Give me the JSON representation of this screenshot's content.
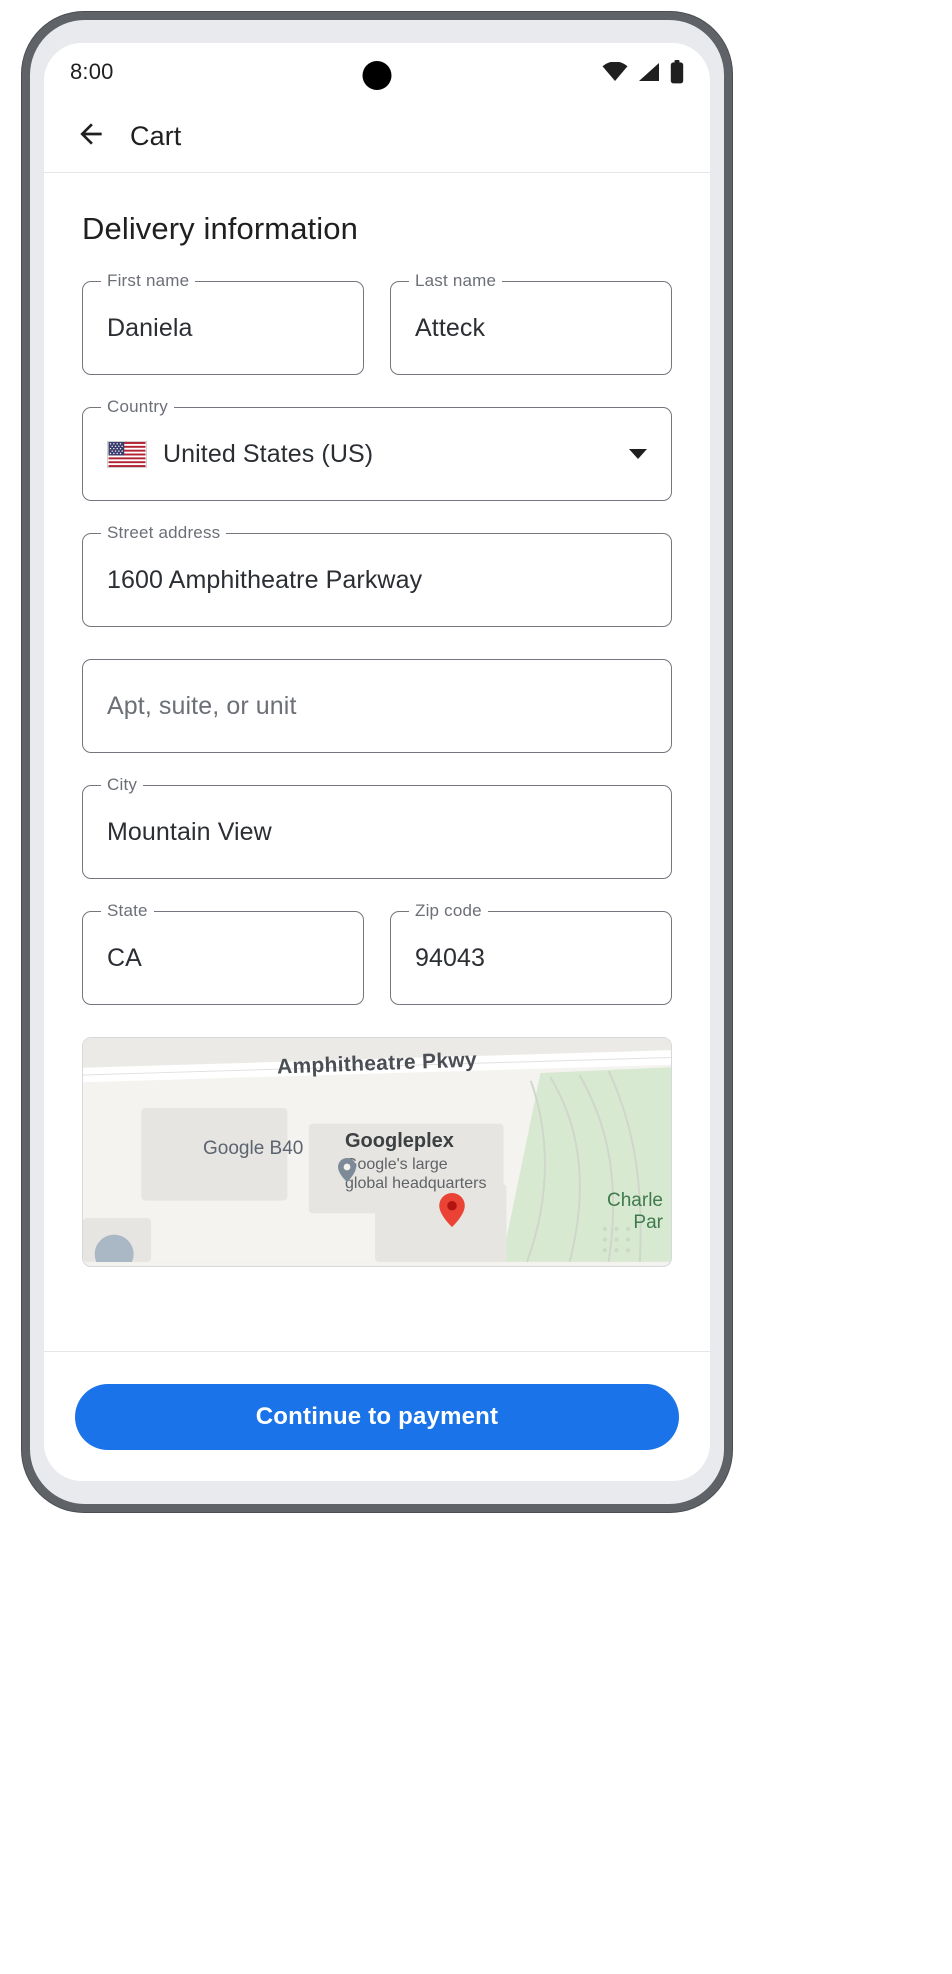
{
  "status_bar": {
    "time": "8:00",
    "icons": [
      "wifi-icon",
      "cellular-signal-icon",
      "battery-icon"
    ]
  },
  "app_bar": {
    "back_icon": "arrow-back-icon",
    "title": "Cart"
  },
  "main": {
    "section_title": "Delivery information",
    "fields": {
      "first_name": {
        "label": "First name",
        "value": "Daniela"
      },
      "last_name": {
        "label": "Last name",
        "value": "Atteck"
      },
      "country": {
        "label": "Country",
        "value": "United States (US)",
        "flag": "🇺🇸"
      },
      "street_address": {
        "label": "Street address",
        "value": "1600 Amphitheatre Parkway"
      },
      "apt": {
        "label": "",
        "value": "",
        "placeholder": "Apt, suite, or unit"
      },
      "city": {
        "label": "City",
        "value": "Mountain View"
      },
      "state": {
        "label": "State",
        "value": "CA"
      },
      "zip": {
        "label": "Zip code",
        "value": "94043"
      }
    },
    "map": {
      "street_label": "Amphitheatre Pkwy",
      "building_label": "Google B40",
      "place_name": "Googleplex",
      "place_desc_line1": "Google's large",
      "place_desc_line2": "global headquarters",
      "park_label": "Charle\nPar"
    }
  },
  "bottom": {
    "cta_label": "Continue to payment",
    "cta_color": "#1a73e8"
  }
}
